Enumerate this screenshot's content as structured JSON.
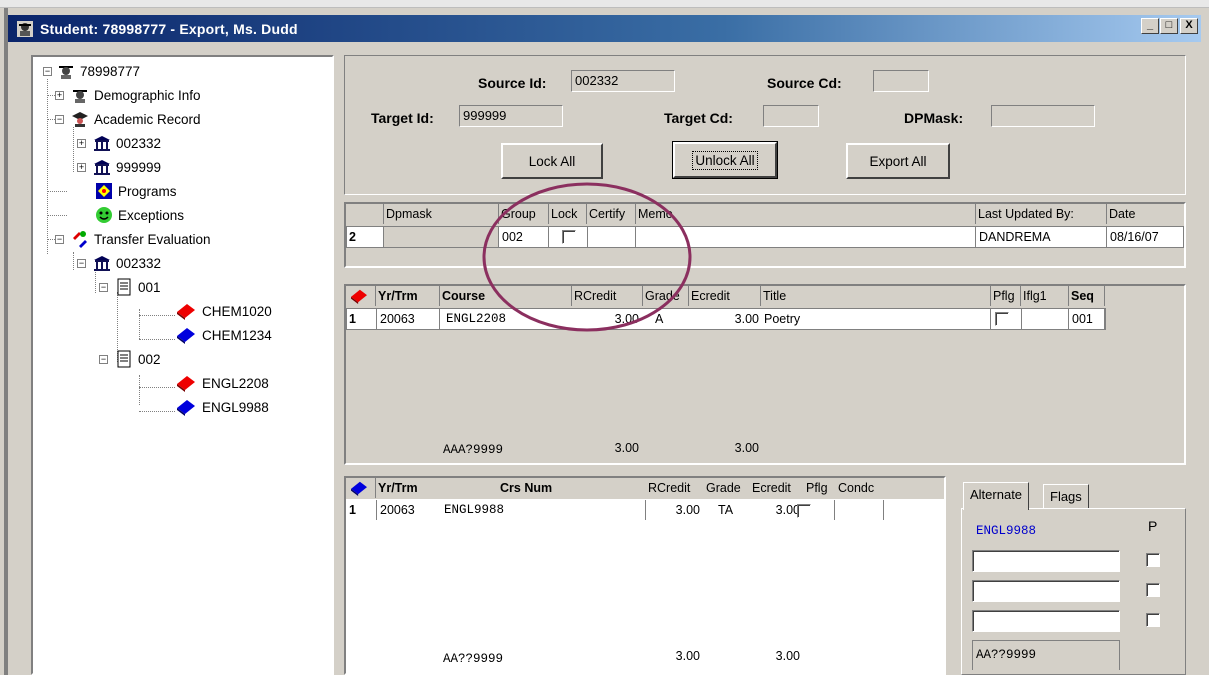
{
  "window": {
    "title": "Student: 78998777 - Export, Ms. Dudd",
    "min": "_",
    "max": "□",
    "close": "X"
  },
  "tree": {
    "root": "78998777",
    "demographic": "Demographic Info",
    "academic": "Academic Record",
    "inst1": "002332",
    "inst2": "999999",
    "programs": "Programs",
    "exceptions": "Exceptions",
    "transfer": "Transfer Evaluation",
    "te_inst": "002332",
    "group1": "001",
    "g1c1": "CHEM1020",
    "g1c2": "CHEM1234",
    "group2": "002",
    "g2c1": "ENGL2208",
    "g2c2": "ENGL9988"
  },
  "form": {
    "source_id_label": "Source Id:",
    "source_id_value": "002332",
    "source_cd_label": "Source Cd:",
    "source_cd_value": "",
    "target_id_label": "Target Id:",
    "target_id_value": "999999",
    "target_cd_label": "Target Cd:",
    "target_cd_value": "",
    "dpmask_label": "DPMask:",
    "dpmask_value": "",
    "lock_all": "Lock All",
    "unlock_all": "Unlock All",
    "export_all": "Export All"
  },
  "group_grid": {
    "headers": {
      "dpmask": "Dpmask",
      "group": "Group",
      "lock": "Lock",
      "certify": "Certify",
      "memo": "Memo",
      "last_updated": "Last Updated By:",
      "date": "Date"
    },
    "row": {
      "num": "2",
      "dpmask": "",
      "group": "002",
      "certify": "",
      "memo": "",
      "last_updated": "DANDREMA",
      "date": "08/16/07"
    }
  },
  "course_grid": {
    "headers": {
      "yrtrm": "Yr/Trm",
      "course": "Course",
      "rcredit": "RCredit",
      "grade": "Grade",
      "ecredit": "Ecredit",
      "title": "Title",
      "pflg": "Pflg",
      "iflg1": "Iflg1",
      "seq": "Seq"
    },
    "rows": [
      {
        "num": "1",
        "yrtrm": "20063",
        "course": "ENGL2208",
        "rcredit": "3.00",
        "grade": "A",
        "ecredit": "3.00",
        "title": "Poetry",
        "iflg1": "",
        "seq": "001"
      }
    ],
    "footer": {
      "mask": "AAA?9999",
      "rcredit": "3.00",
      "ecredit": "3.00"
    }
  },
  "target_grid": {
    "headers": {
      "yrtrm": "Yr/Trm",
      "crsnum": "Crs Num",
      "rcredit": "RCredit",
      "grade": "Grade",
      "ecredit": "Ecredit",
      "pflg": "Pflg",
      "condc": "Condc"
    },
    "rows": [
      {
        "num": "1",
        "yrtrm": "20063",
        "crsnum": "ENGL9988",
        "rcredit": "3.00",
        "grade": "TA",
        "ecredit": "3.00",
        "condc": ""
      }
    ],
    "footer": {
      "mask": "AA??9999",
      "rcredit": "3.00",
      "ecredit": "3.00"
    }
  },
  "side_panel": {
    "tab_alternate": "Alternate",
    "tab_flags": "Flags",
    "course": "ENGL9988",
    "p_label": "P",
    "mask": "AA??9999"
  },
  "colors": {
    "title_start": "#0a246a",
    "highlight_circle": "#8b2f5f",
    "link_blue": "#0000cc"
  }
}
